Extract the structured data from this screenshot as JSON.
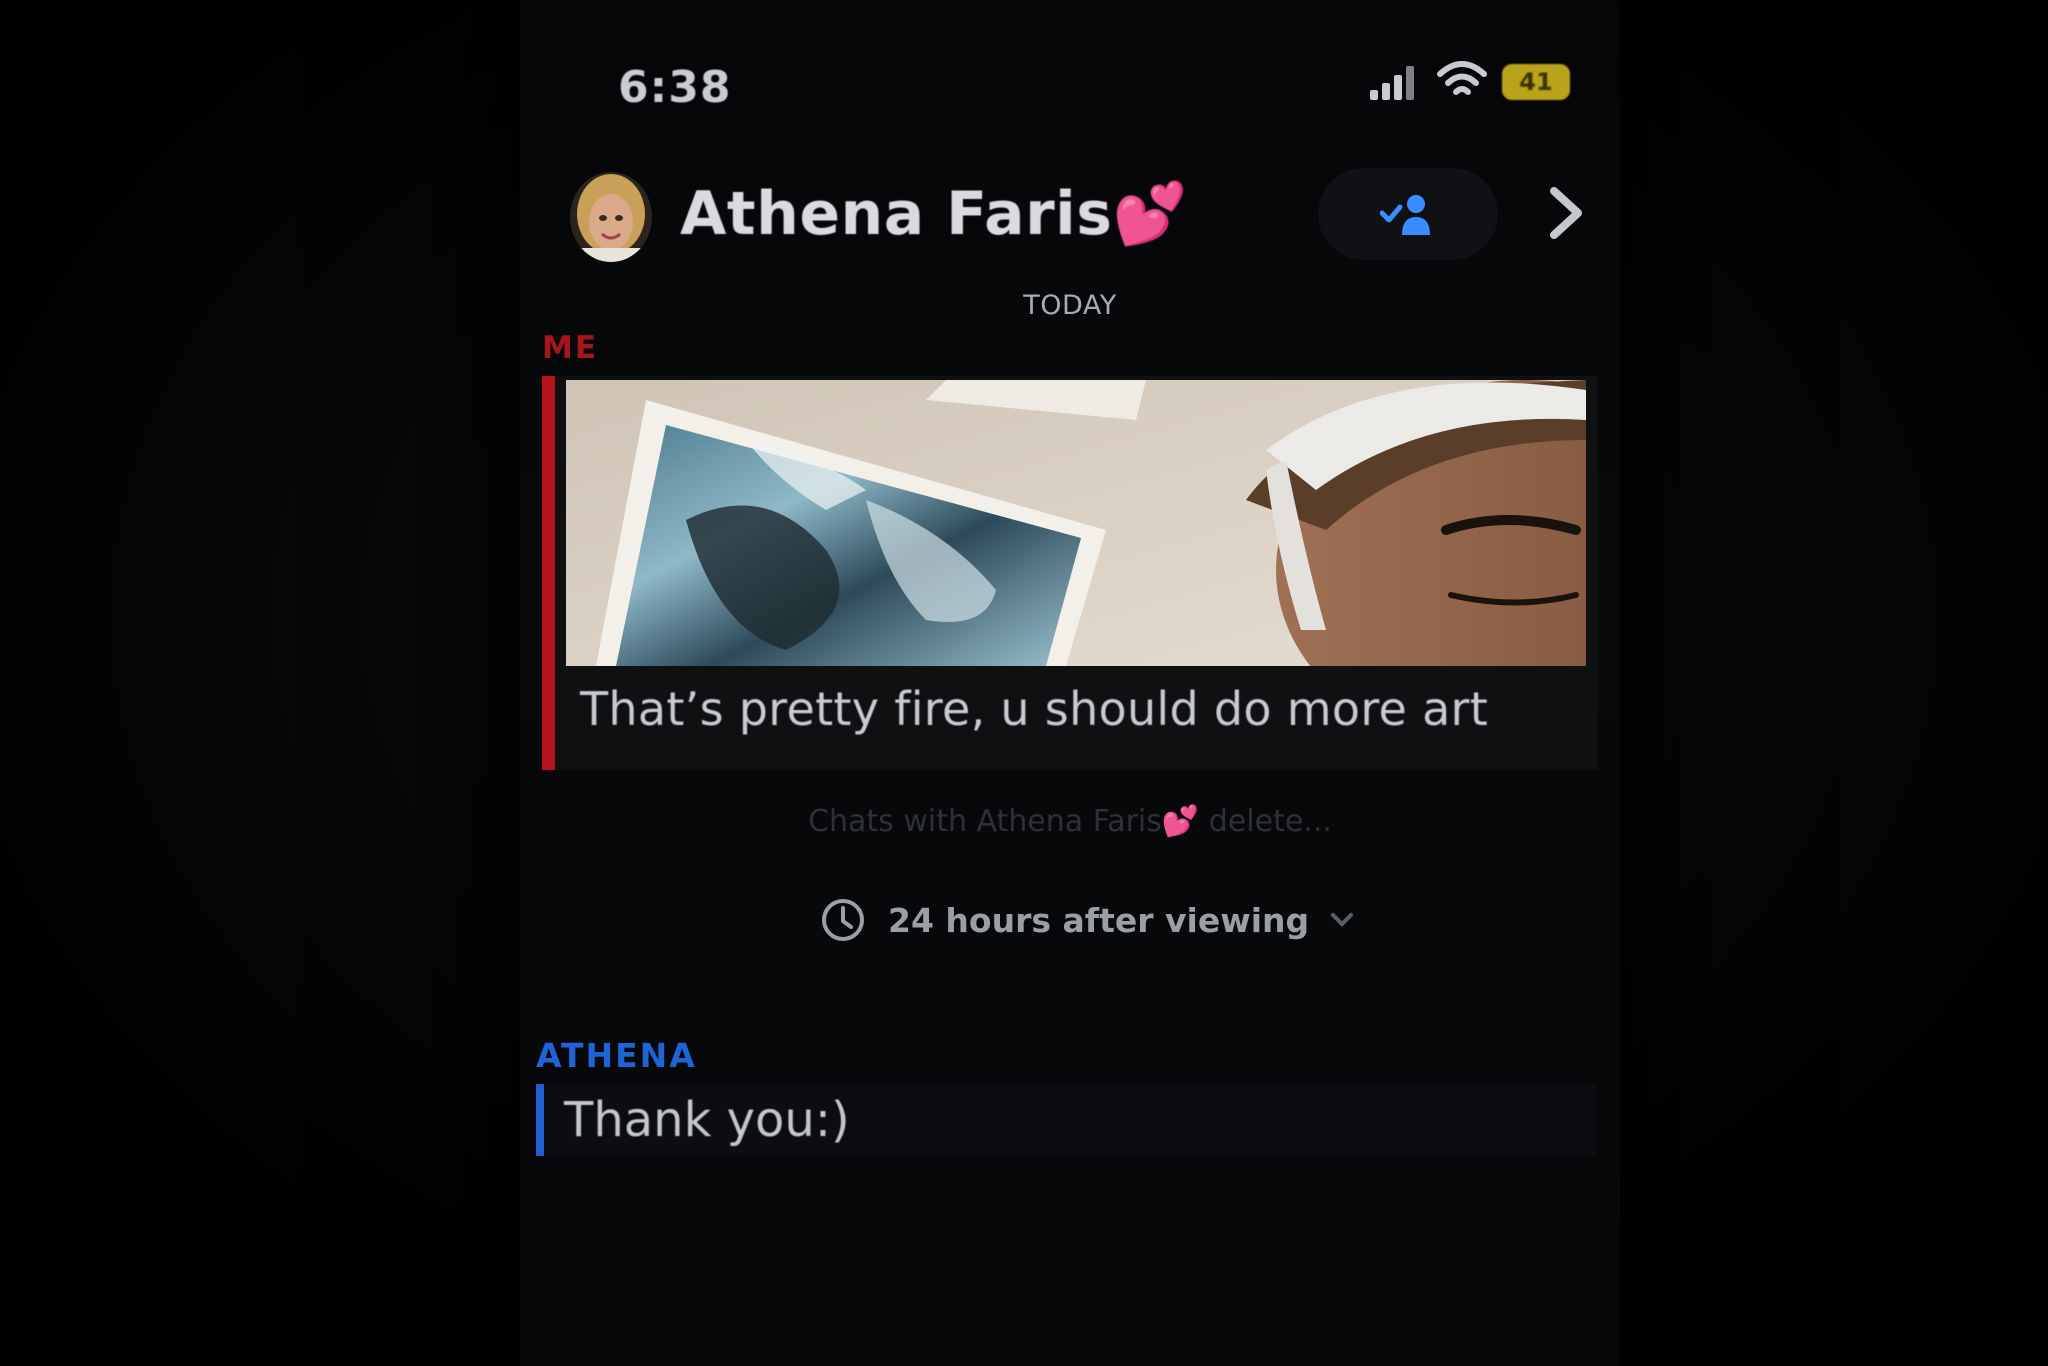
{
  "status_bar": {
    "time": "6:38",
    "battery": "41"
  },
  "header": {
    "contact_name": "Athena Faris💕"
  },
  "conversation": {
    "date_label": "TODAY",
    "sender_me": "ME",
    "message_me": "That’s pretty fire, u should do more art",
    "delete_notice": "Chats with Athena Faris💕 delete...",
    "timer_label": "24 hours after viewing",
    "sender_athena": "ATHENA",
    "message_athena": "Thank you:)"
  },
  "colors": {
    "me_accent": "#b5141d",
    "athena_accent": "#1f5fd0",
    "friend_icon": "#3a8dff"
  },
  "icons": {
    "signal": "signal-icon",
    "wifi": "wifi-icon",
    "battery": "battery-icon",
    "add_friend": "person-check-icon",
    "forward": "chevron-right-icon",
    "timer": "clock-icon",
    "dropdown": "chevron-down-icon"
  }
}
